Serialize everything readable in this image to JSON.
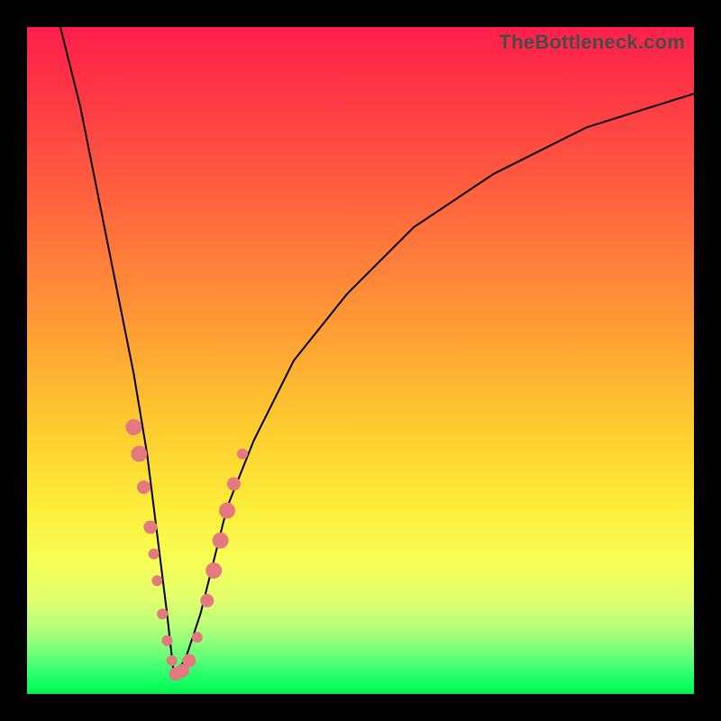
{
  "attribution": "TheBottleneck.com",
  "colors": {
    "frame": "#000000",
    "curve": "#000000",
    "marker": "#e47a7f",
    "gradient_top": "#ff1f4b",
    "gradient_mid": "#fded3a",
    "gradient_bottom": "#04f050"
  },
  "chart_data": {
    "type": "line",
    "title": "",
    "xlabel": "",
    "ylabel": "",
    "xlim": [
      0,
      100
    ],
    "ylim": [
      0,
      100
    ],
    "note": "Axes are unlabeled; values are approximate positions read as percentages of the plot area (0,0 at bottom-left). The curve is a V-shaped bottleneck profile with minimum near x≈22.",
    "series": [
      {
        "name": "bottleneck-curve",
        "x": [
          5,
          8,
          10,
          12,
          14,
          16,
          18,
          19,
          20,
          21,
          22,
          23,
          24,
          26,
          28,
          30,
          34,
          40,
          48,
          58,
          70,
          84,
          100
        ],
        "y": [
          100,
          88,
          78,
          68,
          58,
          48,
          36,
          28,
          20,
          12,
          3,
          4,
          6,
          12,
          20,
          28,
          38,
          50,
          60,
          70,
          78,
          85,
          90
        ]
      }
    ],
    "markers": {
      "name": "highlight-points",
      "note": "Salmon-colored dots clustered around the curve's minimum on both arms.",
      "points": [
        {
          "x": 16.0,
          "y": 40.0,
          "size": "lg"
        },
        {
          "x": 16.8,
          "y": 36.0,
          "size": "lg"
        },
        {
          "x": 17.5,
          "y": 31.0,
          "size": "md"
        },
        {
          "x": 18.5,
          "y": 25.0,
          "size": "md"
        },
        {
          "x": 19.0,
          "y": 21.0,
          "size": "sm"
        },
        {
          "x": 19.5,
          "y": 17.0,
          "size": "sm"
        },
        {
          "x": 20.3,
          "y": 12.0,
          "size": "sm"
        },
        {
          "x": 21.0,
          "y": 8.0,
          "size": "sm"
        },
        {
          "x": 21.7,
          "y": 5.0,
          "size": "sm"
        },
        {
          "x": 22.3,
          "y": 3.0,
          "size": "md"
        },
        {
          "x": 23.3,
          "y": 3.5,
          "size": "md"
        },
        {
          "x": 24.3,
          "y": 5.0,
          "size": "md"
        },
        {
          "x": 25.5,
          "y": 8.5,
          "size": "sm"
        },
        {
          "x": 27.0,
          "y": 14.0,
          "size": "md"
        },
        {
          "x": 28.0,
          "y": 18.5,
          "size": "lg"
        },
        {
          "x": 29.0,
          "y": 23.0,
          "size": "lg"
        },
        {
          "x": 30.0,
          "y": 27.5,
          "size": "lg"
        },
        {
          "x": 31.0,
          "y": 31.5,
          "size": "md"
        },
        {
          "x": 32.3,
          "y": 36.0,
          "size": "sm"
        }
      ]
    }
  }
}
